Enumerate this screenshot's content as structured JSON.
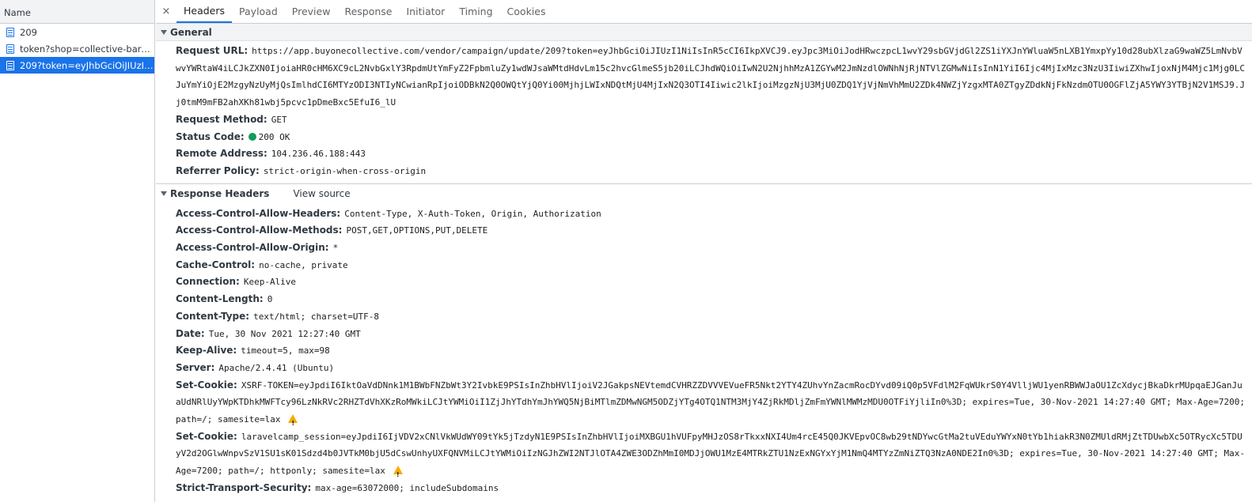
{
  "left_panel": {
    "header": "Name",
    "requests": [
      {
        "label": "209",
        "selected": false
      },
      {
        "label": "token?shop=collective-bargai...",
        "selected": false
      },
      {
        "label": "209?token=eyJhbGciOiJIUzI1...",
        "selected": true
      }
    ]
  },
  "tabs": {
    "close_glyph": "×",
    "items": [
      "Headers",
      "Payload",
      "Preview",
      "Response",
      "Initiator",
      "Timing",
      "Cookies"
    ],
    "active": "Headers"
  },
  "general": {
    "title": "General",
    "request_url_label": "Request URL:",
    "request_url_value": "https://app.buyonecollective.com/vendor/campaign/update/209?token=eyJhbGciOiJIUzI1NiIsInR5cCI6IkpXVCJ9.eyJpc3MiOiJodHRwczpcL1wvY29sbGVjdGl2ZS1iYXJnYWluaW5nLXB1YmxpYy10d28ubXlzaG9waWZ5LmNvbVwvYWRtaW4iLCJkZXN0IjoiaHR0cHM6XC9cL2NvbGxlY3RpdmUtYmFyZ2FpbmluZy1wdWJsaWMtdHdvLm15c2hvcGlmeS5jb20iLCJhdWQiOiIwN2U2NjhhMzA1ZGYwM2JmNzdlOWNhNjRjNTVlZGMwNiIsInN1YiI6Ijc4MjIxMzc3NzU3IiwiZXhwIjoxNjM4Mjc1Mjg0LCJuYmYiOjE2MzgyNzUyMjQsImlhdCI6MTYzODI3NTIyNCwianRpIjoiODBkN2Q0OWQtYjQ0Yi00MjhjLWIxNDQtMjU4MjIxN2Q3OTI4Iiwic2lkIjoiMzgzNjU3MjU0ZDQ1YjVjNmVhMmU2ZDk4NWZjYzgxMTA0ZTgyZDdkNjFkNzdmOTU0OGFlZjA5YWY3YTBjN2V1MSJ9.Jj0tmM9mFB2ahXKh81wbj5pcvc1pDmeBxc5EfuI6_lU",
    "request_method_label": "Request Method:",
    "request_method_value": "GET",
    "status_code_label": "Status Code:",
    "status_code_value": "200 OK",
    "status_color": "#0f9d58",
    "remote_address_label": "Remote Address:",
    "remote_address_value": "104.236.46.188:443",
    "referrer_policy_label": "Referrer Policy:",
    "referrer_policy_value": "strict-origin-when-cross-origin"
  },
  "response_headers": {
    "title": "Response Headers",
    "view_source": "View source",
    "items": [
      {
        "k": "Access-Control-Allow-Headers:",
        "v": "Content-Type, X-Auth-Token, Origin, Authorization"
      },
      {
        "k": "Access-Control-Allow-Methods:",
        "v": "POST,GET,OPTIONS,PUT,DELETE"
      },
      {
        "k": "Access-Control-Allow-Origin:",
        "v": "*"
      },
      {
        "k": "Cache-Control:",
        "v": "no-cache, private"
      },
      {
        "k": "Connection:",
        "v": "Keep-Alive"
      },
      {
        "k": "Content-Length:",
        "v": "0"
      },
      {
        "k": "Content-Type:",
        "v": "text/html; charset=UTF-8"
      },
      {
        "k": "Date:",
        "v": "Tue, 30 Nov 2021 12:27:40 GMT"
      },
      {
        "k": "Keep-Alive:",
        "v": "timeout=5, max=98"
      },
      {
        "k": "Server:",
        "v": "Apache/2.4.41 (Ubuntu)"
      }
    ],
    "set_cookie_1_label": "Set-Cookie:",
    "set_cookie_1_value": "XSRF-TOKEN=eyJpdiI6IktOaVdDNnk1M1BWbFNZbWt3Y2IvbkE9PSIsInZhbHVlIjoiV2JGakpsNEVtemdCVHRZZDVVVEVueFR5Nkt2YTY4ZUhvYnZacmRocDYvd09iQ0p5VFdlM2FqWUkrS0Y4VlljWU1yenRBWWJaOU1ZcXdycjBkaDkrMUpqaEJGanJuaUdNRlUyYWpKTDhkMWFTcy96LzNkRVc2RHZTdVhXKzRoMWkiLCJtYWMiOiI1ZjJhYTdhYmJhYWQ5NjBiMTlmZDMwNGM5ODZjYTg4OTQ1NTM3MjY4ZjRkMDljZmFmYWNlMWMzMDU0OTFiYjliIn0%3D; expires=Tue, 30-Nov-2021 14:27:40 GMT; Max-Age=7200; path=/; samesite=lax",
    "set_cookie_2_label": "Set-Cookie:",
    "set_cookie_2_value": "laravelcamp_session=eyJpdiI6IjVDV2xCNlVkWUdWY09tYk5jTzdyN1E9PSIsInZhbHVlIjoiMXBGU1hVUFpyMHJzOS8rTkxxNXI4Um4rcE45Q0JKVEpvOC8wb29tNDYwcGtMa2tuVEduYWYxN0tYb1hiakR3N0ZMUldRMjZtTDUwbXc5OTRycXc5TDUyV2d2OGlwWnpvSzV1SU1sK01Sdzd4b0JVTkM0bjU5dCswUnhyUXFQNVMiLCJtYWMiOiIzNGJhZWI2NTJlOTA4ZWE3ODZhMmI0MDJjOWU1MzE4MTRkZTU1NzExNGYxYjM1NmQ4MTYzZmNiZTQ3NzA0NDE2In0%3D; expires=Tue, 30-Nov-2021 14:27:40 GMT; Max-Age=7200; path=/; httponly; samesite=lax",
    "sts_label": "Strict-Transport-Security:",
    "sts_value": "max-age=63072000; includeSubdomains",
    "warning_color": "#f9ab00"
  }
}
